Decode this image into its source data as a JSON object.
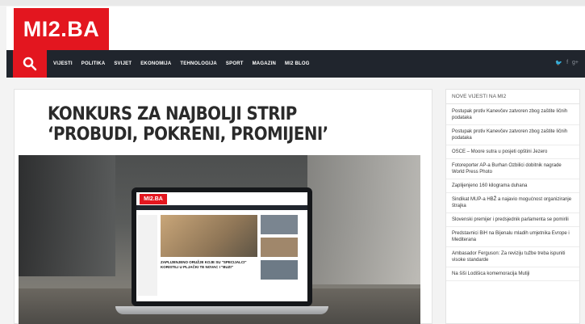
{
  "site": {
    "logo": "MI2.BA"
  },
  "nav": {
    "items": [
      "VIJESTI",
      "POLITIKA",
      "SVIJET",
      "EKONOMIJA",
      "TEHNOLOGIJA",
      "SPORT",
      "MAGAZIN",
      "MI2 BLOG"
    ],
    "social": [
      "twitter-icon",
      "facebook-icon",
      "googleplus-icon"
    ]
  },
  "article": {
    "title": "KONKURS ZA NAJBOLJI STRIP ‘PROBUDI, POKRENI, PROMIJENI’"
  },
  "hero": {
    "screen_logo": "MI2.BA",
    "screen_caption": "ZAPLIJENJENO ORUŽJE KOJE SU \"SPECIJALCI\" KORISTILI U PLJAČKI TE NOVAC I \"BUZI\""
  },
  "sidebar": {
    "heading": "NOVE VIJESTI NA MI2",
    "items": [
      "Postupak protiv Kanevčev zatvoren zbog zaštite ličnih podataka",
      "Postupak protiv Kanevčev zatvoren zbog zaštite ličnih podataka",
      "OSCE – Moore sutra u posjeti opštini Jezero",
      "Fotoreporter AP-a Burhan Ozbilici dobitnik nagrade World Press Photo",
      "Zaplijenjeno 160 kilograma duhana",
      "Sindikat MUP-a HBŽ a najavio mogućnost organiziranje štrajka",
      "Slovenski premijer i predsjednik parlamenta se pomirili",
      "Predstavnici BiH na Bijenalu mladih umjetnika Evrope i Mediterana",
      "Ambasador Ferguson: Za reviziju tužbe treba ispuniti visoke standarde",
      "Na šiši Lodišica komemoracija Mutiji"
    ]
  },
  "colors": {
    "brand_red": "#e3161f",
    "nav_dark": "#20252d"
  }
}
